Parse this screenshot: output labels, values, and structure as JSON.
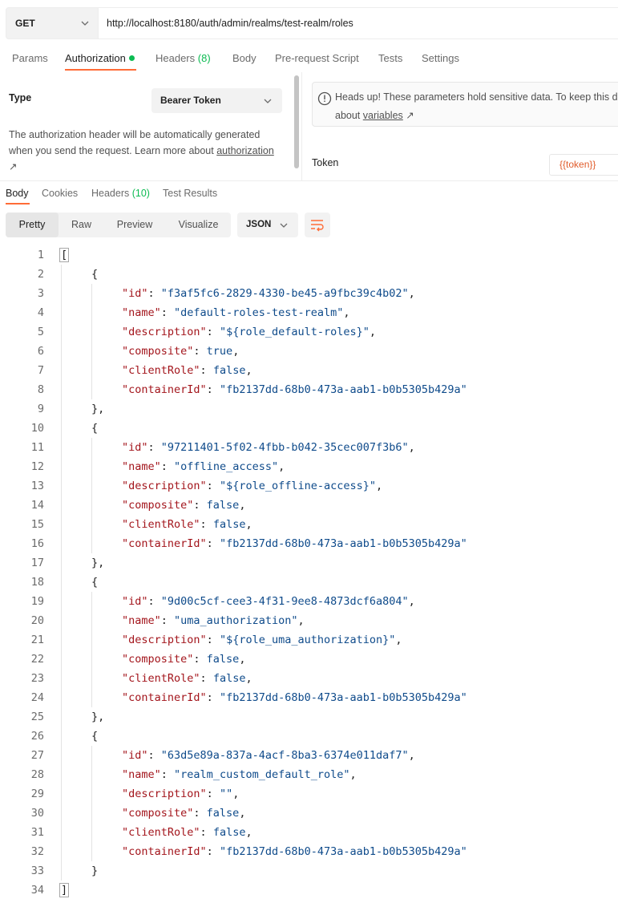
{
  "request": {
    "method": "GET",
    "url": "http://localhost:8180/auth/admin/realms/test-realm/roles"
  },
  "request_tabs": [
    {
      "label": "Params",
      "count": ""
    },
    {
      "label": "Authorization",
      "count": ""
    },
    {
      "label": "Headers",
      "count": "(8)"
    },
    {
      "label": "Body",
      "count": ""
    },
    {
      "label": "Pre-request Script",
      "count": ""
    },
    {
      "label": "Tests",
      "count": ""
    },
    {
      "label": "Settings",
      "count": ""
    }
  ],
  "auth": {
    "type_label": "Type",
    "type_value": "Bearer Token",
    "description": "The authorization header will be automatically generated when you send the request. Learn more about ",
    "description_link": "authorization",
    "link_arrow": "↗",
    "notice_line1": "Heads up! These parameters hold sensitive data. To keep this d",
    "notice_line2_prefix": "about ",
    "notice_link": "variables",
    "token_label": "Token",
    "token_value": "{{token}}"
  },
  "response_tabs": [
    {
      "label": "Body",
      "count": ""
    },
    {
      "label": "Cookies",
      "count": ""
    },
    {
      "label": "Headers",
      "count": "(10)"
    },
    {
      "label": "Test Results",
      "count": ""
    }
  ],
  "view_modes": [
    "Pretty",
    "Raw",
    "Preview",
    "Visualize"
  ],
  "format": "JSON",
  "colors": {
    "accent": "#ff6c37",
    "status_green": "#0cbb52",
    "json_key": "#a3151c",
    "json_value": "#0f4b8b"
  },
  "roles": [
    {
      "id": "f3af5fc6-2829-4330-be45-a9fbc39c4b02",
      "name": "default-roles-test-realm",
      "description": "${role_default-roles}",
      "composite": "true",
      "clientRole": "false",
      "containerId": "fb2137dd-68b0-473a-aab1-b0b5305b429a"
    },
    {
      "id": "97211401-5f02-4fbb-b042-35cec007f3b6",
      "name": "offline_access",
      "description": "${role_offline-access}",
      "composite": "false",
      "clientRole": "false",
      "containerId": "fb2137dd-68b0-473a-aab1-b0b5305b429a"
    },
    {
      "id": "9d00c5cf-cee3-4f31-9ee8-4873dcf6a804",
      "name": "uma_authorization",
      "description": "${role_uma_authorization}",
      "composite": "false",
      "clientRole": "false",
      "containerId": "fb2137dd-68b0-473a-aab1-b0b5305b429a"
    },
    {
      "id": "63d5e89a-837a-4acf-8ba3-6374e011daf7",
      "name": "realm_custom_default_role",
      "description": "",
      "composite": "false",
      "clientRole": "false",
      "containerId": "fb2137dd-68b0-473a-aab1-b0b5305b429a"
    }
  ]
}
